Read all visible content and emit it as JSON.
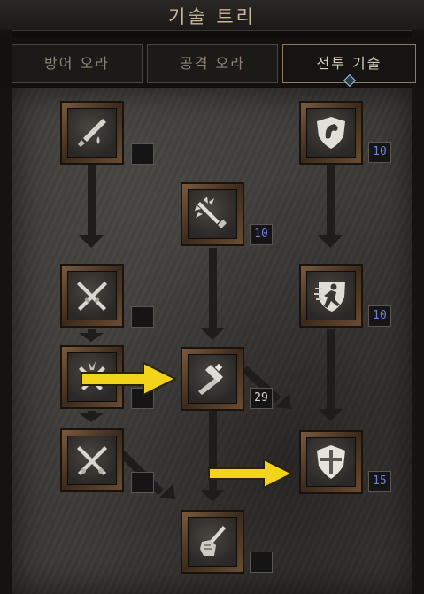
{
  "title": "기술 트리",
  "tabs": [
    {
      "label": "방어 오라",
      "active": false
    },
    {
      "label": "공격 오라",
      "active": false
    },
    {
      "label": "전투 기술",
      "active": true
    }
  ],
  "skills": [
    {
      "icon": "sword-blood-icon",
      "level": ""
    },
    {
      "icon": "charging-sword-icon",
      "level": "10"
    },
    {
      "icon": "dragon-shield-icon",
      "level": "10"
    },
    {
      "icon": "crossed-swords-icon",
      "level": ""
    },
    {
      "icon": "running-figure-shield-icon",
      "level": "10"
    },
    {
      "icon": "flaming-crossed-swords-icon",
      "level": ""
    },
    {
      "icon": "holy-hammer-icon",
      "level": "29"
    },
    {
      "icon": "holy-shield-icon",
      "level": "15"
    },
    {
      "icon": "crossed-blades-icon",
      "level": ""
    },
    {
      "icon": "fist-of-heavens-icon",
      "level": ""
    }
  ],
  "highlight_arrows": [
    "arrow-to-holy-hammer",
    "arrow-to-holy-shield"
  ],
  "colors": {
    "accent_level": "#6f7de0",
    "highlight_arrow": "#f2d41a",
    "active_tab_marker": "#9fc3d8"
  }
}
